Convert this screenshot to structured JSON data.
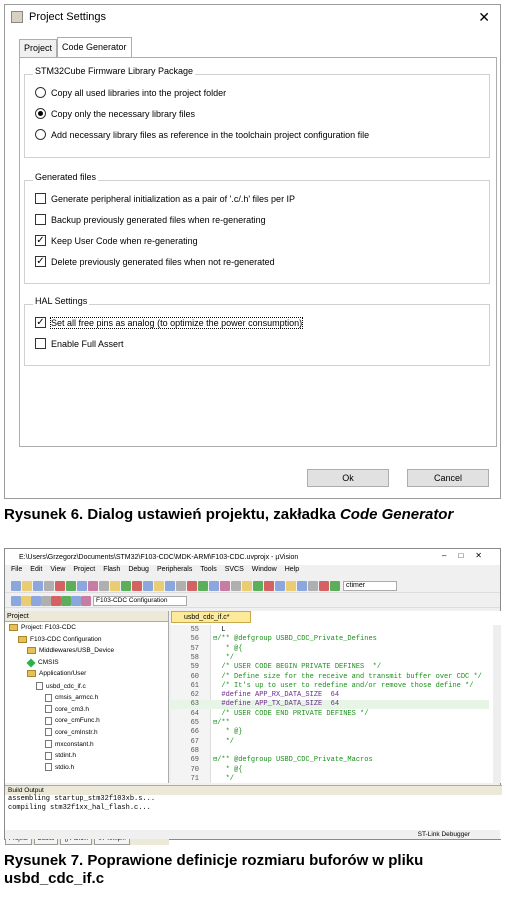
{
  "dialog": {
    "title": "Project Settings",
    "close": "✕",
    "tabs": [
      "Project",
      "Code Generator"
    ],
    "groups": {
      "firmware": {
        "label": "STM32Cube Firmware Library Package",
        "options": [
          {
            "label": "Copy all used libraries into the project folder",
            "selected": false
          },
          {
            "label": "Copy only the necessary library files",
            "selected": true
          },
          {
            "label": "Add necessary library files as reference in the toolchain project configuration file",
            "selected": false
          }
        ]
      },
      "generated": {
        "label": "Generated files",
        "options": [
          {
            "label": "Generate peripheral initialization as a pair of '.c/.h' files per IP",
            "checked": false
          },
          {
            "label": "Backup previously generated files when re-generating",
            "checked": false
          },
          {
            "label": "Keep User Code when re-generating",
            "checked": true
          },
          {
            "label": "Delete previously generated files when not re-generated",
            "checked": true
          }
        ]
      },
      "hal": {
        "label": "HAL Settings",
        "options": [
          {
            "label": "Set all free pins as analog (to optimize the power consumption)",
            "checked": true
          },
          {
            "label": "Enable Full Assert",
            "checked": false
          }
        ]
      }
    },
    "ok": "Ok",
    "cancel": "Cancel"
  },
  "caption1": {
    "prefix": "Rysunek 6. Dialog ustawień projektu, zakładka ",
    "emph": "Code Generator"
  },
  "ide": {
    "title": "E:\\Users\\Grzegorz\\Documents\\STM32\\F103-CDC\\MDK-ARM\\F103-CDC.uvprojx - µVision",
    "menu": [
      "File",
      "Edit",
      "View",
      "Project",
      "Flash",
      "Debug",
      "Peripherals",
      "Tools",
      "SVCS",
      "Window",
      "Help"
    ],
    "target": "F103-CDC Configuration",
    "search": "ctimer",
    "project_header": "Project",
    "tree": [
      {
        "label": "Project: F103-CDC",
        "depth": 0,
        "kind": "proj"
      },
      {
        "label": "F103-CDC Configuration",
        "depth": 1,
        "kind": "folder"
      },
      {
        "label": "Middlewares/USB_Device",
        "depth": 2,
        "kind": "folder"
      },
      {
        "label": "CMSIS",
        "depth": 2,
        "kind": "gem"
      },
      {
        "label": "Application/User",
        "depth": 2,
        "kind": "folder"
      },
      {
        "label": "usbd_cdc_if.c",
        "depth": 3,
        "kind": "file"
      },
      {
        "label": "cmsis_armcc.h",
        "depth": 4,
        "kind": "file"
      },
      {
        "label": "core_cm3.h",
        "depth": 4,
        "kind": "file"
      },
      {
        "label": "core_cmFunc.h",
        "depth": 4,
        "kind": "file"
      },
      {
        "label": "core_cmInstr.h",
        "depth": 4,
        "kind": "file"
      },
      {
        "label": "mxconstant.h",
        "depth": 4,
        "kind": "file"
      },
      {
        "label": "stdint.h",
        "depth": 4,
        "kind": "file"
      },
      {
        "label": "stdio.h",
        "depth": 4,
        "kind": "file"
      }
    ],
    "panel_tabs": [
      "Project",
      "Books",
      "{} Func...",
      "0↓ Temp..."
    ],
    "editor_tab": "usbd_cdc_if.c*",
    "code": [
      {
        "n": "55",
        "t": "  L",
        "cls": ""
      },
      {
        "n": "56",
        "t": "⊟/** @defgroup USBD_CDC_Private_Defines",
        "cls": "c"
      },
      {
        "n": "57",
        "t": "   * @{",
        "cls": "c"
      },
      {
        "n": "58",
        "t": "   */",
        "cls": "c"
      },
      {
        "n": "59",
        "t": "  /* USER CODE BEGIN PRIVATE DEFINES  */",
        "cls": "c"
      },
      {
        "n": "60",
        "t": "  /* Define size for the receive and transmit buffer over CDC */",
        "cls": "c"
      },
      {
        "n": "61",
        "t": "  /* It's up to user to redefine and/or remove those define */",
        "cls": "c"
      },
      {
        "n": "62",
        "t": "  #define APP_RX_DATA_SIZE  64",
        "cls": "pp"
      },
      {
        "n": "63",
        "t": "  #define APP_TX_DATA_SIZE  64",
        "cls": "pp hl"
      },
      {
        "n": "64",
        "t": "  /* USER CODE END PRIVATE DEFINES */",
        "cls": "c"
      },
      {
        "n": "65",
        "t": "⊟/**",
        "cls": "c"
      },
      {
        "n": "66",
        "t": "   * @}",
        "cls": "c"
      },
      {
        "n": "67",
        "t": "   */",
        "cls": "c"
      },
      {
        "n": "68",
        "t": "",
        "cls": ""
      },
      {
        "n": "69",
        "t": "⊟/** @defgroup USBD_CDC_Private_Macros",
        "cls": "c"
      },
      {
        "n": "70",
        "t": "   * @{",
        "cls": "c"
      },
      {
        "n": "71",
        "t": "   */",
        "cls": "c"
      }
    ],
    "output_header": "Build Output",
    "output": [
      "assembling startup_stm32f103xb.s...",
      "compiling stm32f1xx_hal_flash.c..."
    ],
    "status": "ST-Link Debugger"
  },
  "caption2": {
    "line1": "Rysunek 7. Poprawione definicje rozmiaru buforów w pliku",
    "line2": "usbd_cdc_if.c"
  }
}
